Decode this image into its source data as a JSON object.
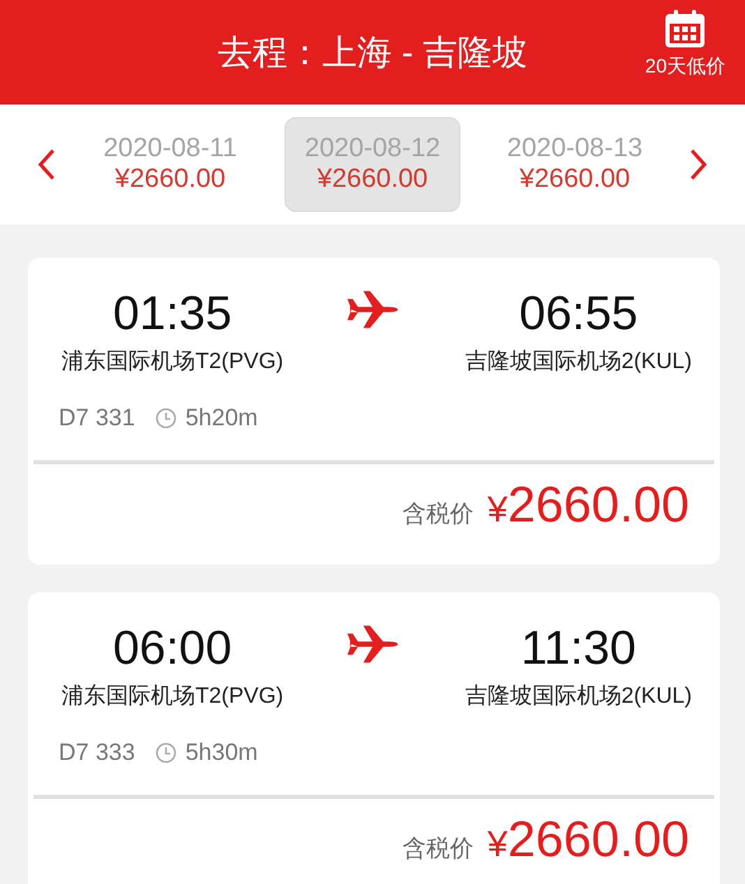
{
  "header": {
    "title": "去程：上海 - 吉隆坡",
    "calendar_label": "20天低价"
  },
  "dates": [
    {
      "date": "2020-08-11",
      "price": "¥2660.00",
      "selected": false
    },
    {
      "date": "2020-08-12",
      "price": "¥2660.00",
      "selected": true
    },
    {
      "date": "2020-08-13",
      "price": "¥2660.00",
      "selected": false
    }
  ],
  "flights": [
    {
      "depart_time": "01:35",
      "depart_airport": "浦东国际机场T2(PVG)",
      "arrive_time": "06:55",
      "arrive_airport": "吉隆坡国际机场2(KUL)",
      "flight_no": "D7 331",
      "duration": "5h20m",
      "price_label": "含税价",
      "currency": "¥",
      "price": "2660.00"
    },
    {
      "depart_time": "06:00",
      "depart_airport": "浦东国际机场T2(PVG)",
      "arrive_time": "11:30",
      "arrive_airport": "吉隆坡国际机场2(KUL)",
      "flight_no": "D7 333",
      "duration": "5h30m",
      "price_label": "含税价",
      "currency": "¥",
      "price": "2660.00"
    }
  ]
}
